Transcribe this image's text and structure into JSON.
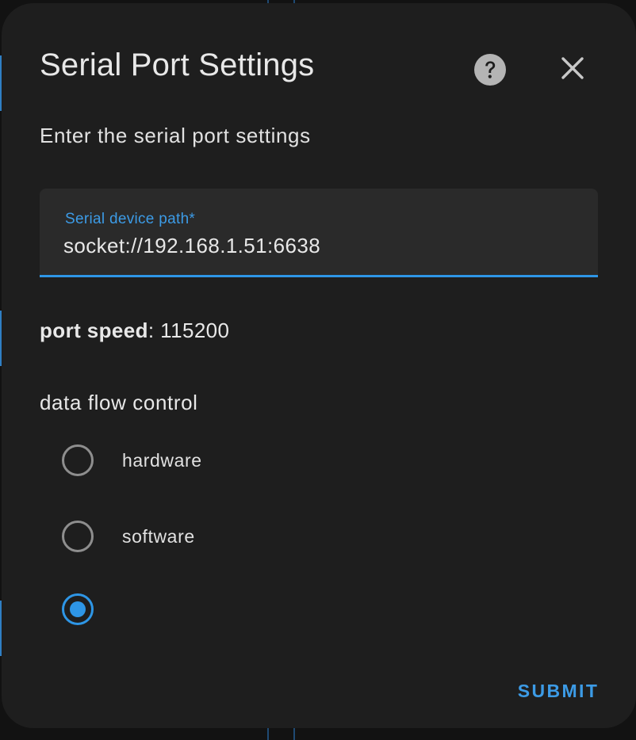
{
  "dialog": {
    "title": "Serial Port Settings",
    "subtitle": "Enter the serial port settings"
  },
  "icons": {
    "help": "help-circle-icon",
    "close": "close-icon"
  },
  "serial_path_field": {
    "label": "Serial device path*",
    "value": "socket://192.168.1.51:6638"
  },
  "port_speed": {
    "label": "port speed",
    "value": ": 115200"
  },
  "flow_control": {
    "title": "data flow control",
    "options": [
      {
        "label": "hardware",
        "checked": false
      },
      {
        "label": "software",
        "checked": false
      },
      {
        "label": "",
        "checked": true
      }
    ]
  },
  "actions": {
    "submit_label": "SUBMIT"
  },
  "colors": {
    "accent": "#2e96e6",
    "dialog_bg": "#1e1e1e",
    "field_bg": "#2a2a2a",
    "text": "#e8e8e8",
    "radio_unchecked": "#8e8e8e"
  }
}
